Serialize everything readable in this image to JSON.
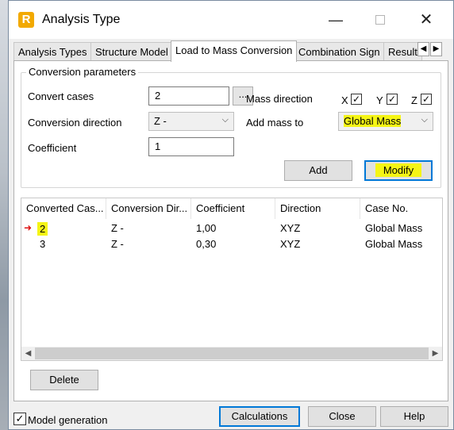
{
  "window": {
    "title": "Analysis Type",
    "app_icon": "R"
  },
  "tabs": [
    {
      "label": "Analysis Types"
    },
    {
      "label": "Structure Model"
    },
    {
      "label": "Load to Mass Conversion"
    },
    {
      "label": "Combination Sign"
    },
    {
      "label": "Result"
    }
  ],
  "group": {
    "title": "Conversion parameters",
    "convert_cases_label": "Convert cases",
    "convert_cases_value": "2",
    "browse_label": "...",
    "conversion_direction_label": "Conversion direction",
    "conversion_direction_value": "Z -",
    "coefficient_label": "Coefficient",
    "coefficient_value": "1",
    "mass_direction_label": "Mass direction",
    "x_label": "X",
    "y_label": "Y",
    "z_label": "Z",
    "x_checked": true,
    "y_checked": true,
    "z_checked": true,
    "add_mass_to_label": "Add mass to",
    "add_mass_to_value": "Global Mass",
    "add_label": "Add",
    "modify_label": "Modify"
  },
  "table": {
    "columns": [
      "Converted Cas...",
      "Conversion Dir...",
      "Coefficient",
      "Direction",
      "Case No."
    ],
    "rows": [
      {
        "converted_case": "2",
        "conversion_direction": "Z -",
        "coefficient": "1,00",
        "direction": "XYZ",
        "case_no": "Global Mass",
        "selected": true
      },
      {
        "converted_case": "3",
        "conversion_direction": "Z -",
        "coefficient": "0,30",
        "direction": "XYZ",
        "case_no": "Global Mass",
        "selected": false
      }
    ]
  },
  "delete_label": "Delete",
  "footer": {
    "model_generation_label": "Model generation",
    "model_generation_checked": true,
    "calculations_label": "Calculations",
    "close_label": "Close",
    "help_label": "Help"
  },
  "colors": {
    "highlight": "#f5f515",
    "accent": "#0078d7",
    "arrow": "#dd1111"
  },
  "icons": {
    "checkmark": "✓",
    "close": "✕",
    "minimize": "—",
    "chevron_down": "⌵",
    "arrow_left": "◀",
    "arrow_right": "▶",
    "row_pointer": "➜"
  }
}
